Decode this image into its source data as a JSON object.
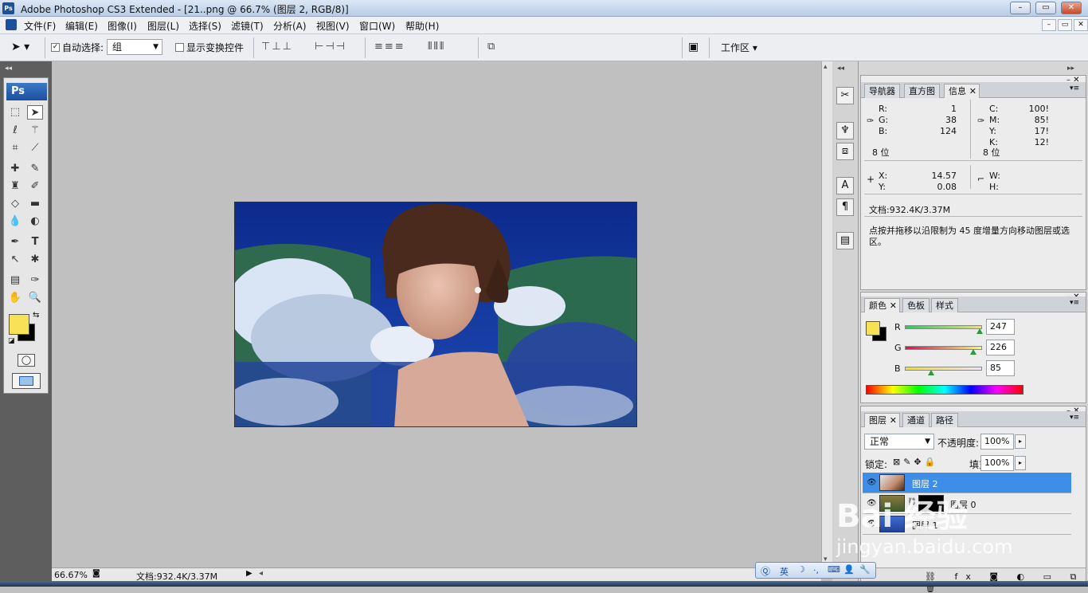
{
  "titlebar": {
    "app_icon": "Ps",
    "title": "Adobe Photoshop CS3 Extended - [21..png @ 66.7% (图层 2, RGB/8)]",
    "min": "–",
    "max": "▭",
    "close": "✕"
  },
  "menu": [
    "文件(F)",
    "编辑(E)",
    "图像(I)",
    "图层(L)",
    "选择(S)",
    "滤镜(T)",
    "分析(A)",
    "视图(V)",
    "窗口(W)",
    "帮助(H)"
  ],
  "options": {
    "auto_select_label": "自动选择:",
    "auto_select_value": "组",
    "show_transform_label": "显示变换控件",
    "workspace_label": "工作区 ▾",
    "auto_select_checked": "✓"
  },
  "toolbox": {
    "logo": "Ps"
  },
  "status": {
    "zoom": "66.67%",
    "doc": "文档:932.4K/3.37M"
  },
  "info_panel": {
    "tabs": [
      "导航器",
      "直方图",
      "信息"
    ],
    "rgb": {
      "r_label": "R:",
      "g_label": "G:",
      "b_label": "B:",
      "r": "1",
      "g": "38",
      "b": "124",
      "bits": "8 位"
    },
    "cmyk": {
      "c_label": "C:",
      "m_label": "M:",
      "y_label": "Y:",
      "k_label": "K:",
      "c": "100!",
      "m": "85!",
      "y": "17!",
      "k": "12!",
      "bits": "8 位"
    },
    "xy": {
      "x_label": "X:",
      "y_label": "Y:",
      "x": "14.57",
      "y": "0.08",
      "w_label": "W:",
      "h_label": "H:"
    },
    "doc": "文档:932.4K/3.37M",
    "hint": "点按并拖移以沿限制为 45 度增量方向移动图层或选区。"
  },
  "color_panel": {
    "tabs": [
      "颜色",
      "色板",
      "样式"
    ],
    "r_label": "R",
    "g_label": "G",
    "b_label": "B",
    "r": "247",
    "g": "226",
    "b": "85",
    "fg_color": "#f7e255",
    "bg_color": "#000000"
  },
  "layers_panel": {
    "tabs": [
      "图层",
      "通道",
      "路径"
    ],
    "blend_mode": "正常",
    "opacity_label": "不透明度:",
    "opacity": "100%",
    "lock_label": "锁定:",
    "fill_label": "填充:",
    "fill": "100%",
    "layers": [
      {
        "name": "图层 2"
      },
      {
        "name": "图层 0"
      },
      {
        "name": "图层 1"
      }
    ]
  },
  "ime": {
    "label": "英"
  },
  "watermark": {
    "line1": "Bai 经验",
    "line2": "jingyan.baidu.com"
  }
}
